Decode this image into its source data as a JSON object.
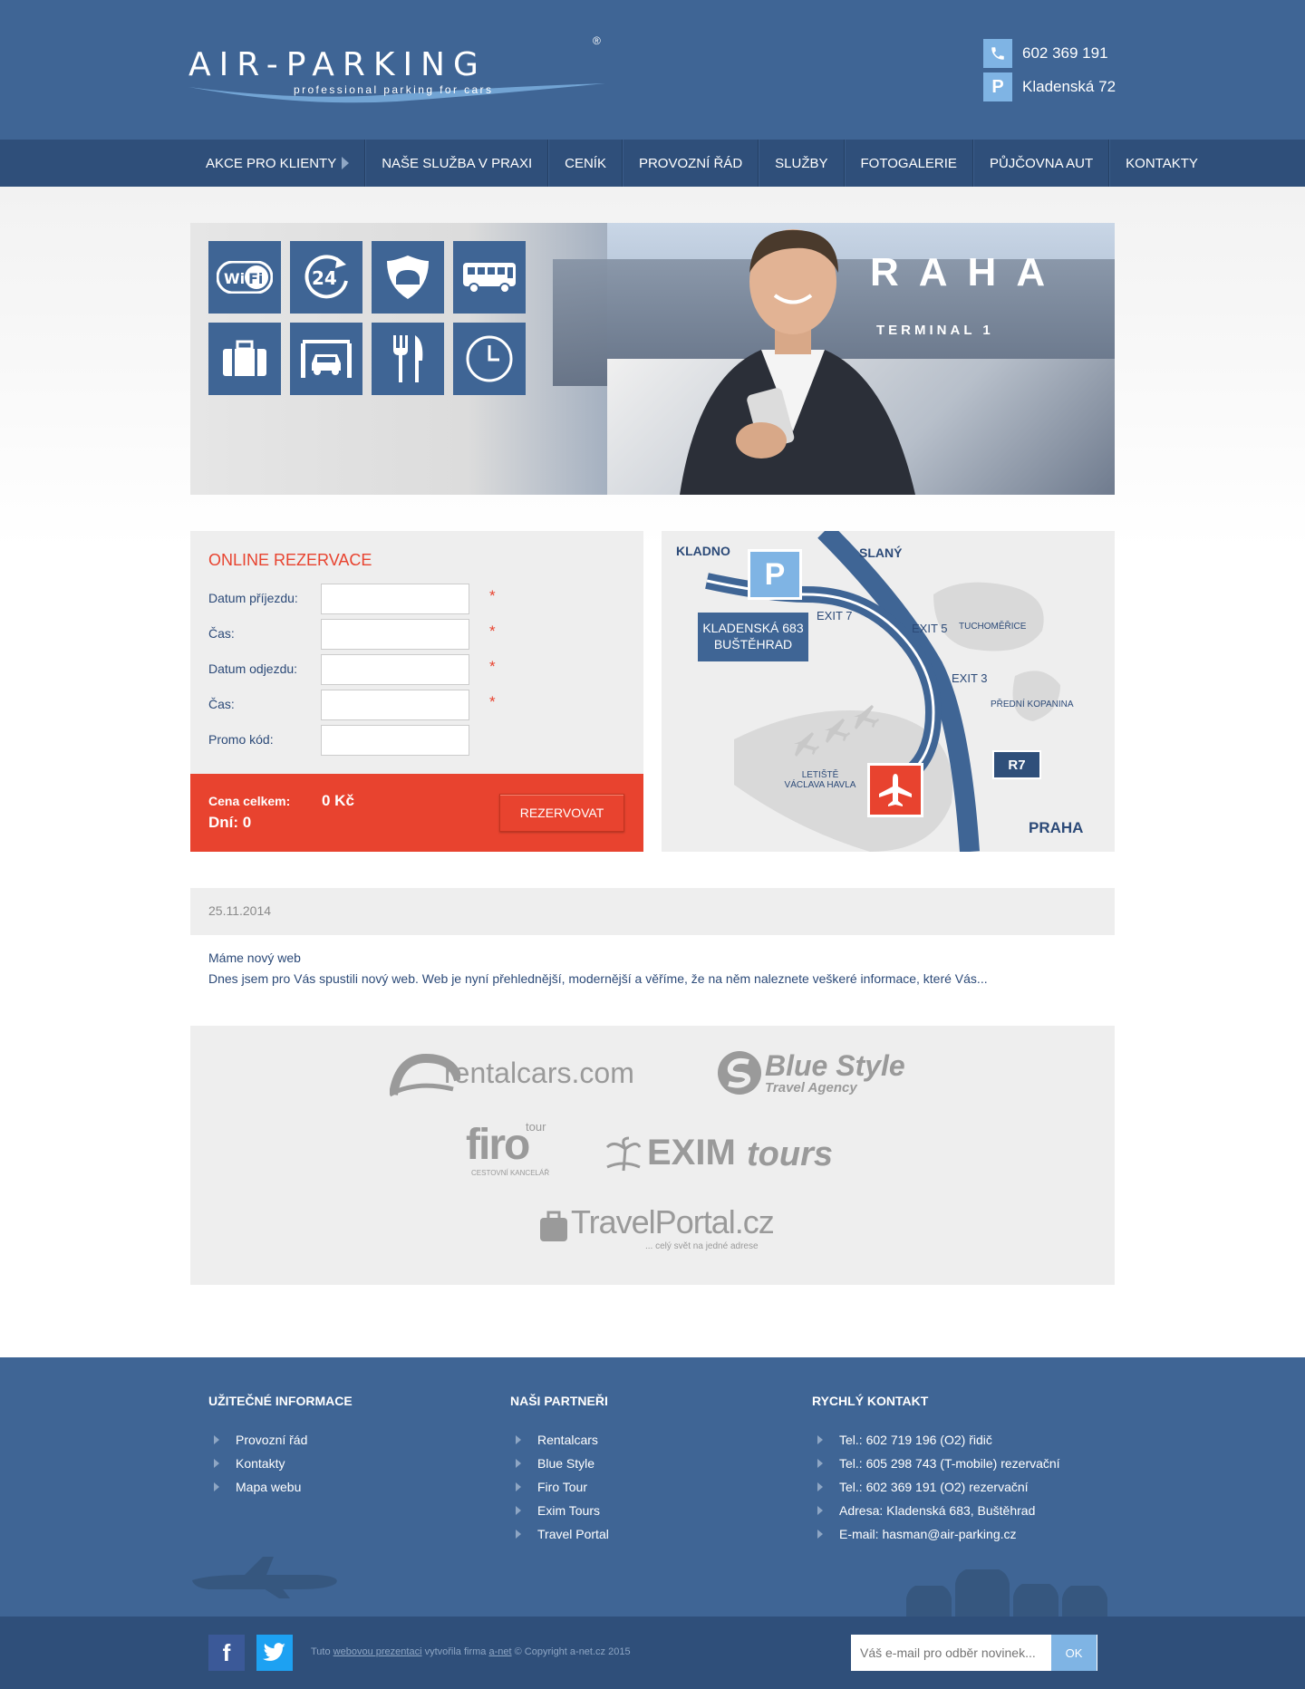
{
  "header": {
    "logo_text": "AIR-PARKING",
    "logo_reg": "®",
    "logo_tagline": "professional parking for cars",
    "phone": "602 369 191",
    "address": "Kladenská 72",
    "phone_icon": "phone-icon",
    "parking_icon_letter": "P"
  },
  "nav": {
    "items": [
      {
        "label": "AKCE PRO KLIENTY"
      },
      {
        "label": "NAŠE SLUŽBA V PRAXI"
      },
      {
        "label": "CENÍK"
      },
      {
        "label": "PROVOZNÍ ŘÁD"
      },
      {
        "label": "SLUŽBY"
      },
      {
        "label": "FOTOGALERIE"
      },
      {
        "label": "PŮJČOVNA AUT"
      },
      {
        "label": "KONTAKTY"
      }
    ]
  },
  "hero": {
    "sign_text": "RAHA",
    "terminal_text": "TERMINAL 1",
    "services": [
      "wifi-icon",
      "24h-icon",
      "security-shield-icon",
      "shuttle-bus-icon",
      "luggage-icon",
      "car-wash-icon",
      "restaurant-icon",
      "clock-icon"
    ],
    "wifi_label": "WiFi",
    "hours_label": "24"
  },
  "reservation": {
    "title": "ONLINE REZERVACE",
    "fields": [
      {
        "label": "Datum příjezdu:",
        "value": "",
        "required": "*"
      },
      {
        "label": "Čas:",
        "value": "",
        "required": "*"
      },
      {
        "label": "Datum odjezdu:",
        "value": "",
        "required": "*"
      },
      {
        "label": "Čas:",
        "value": "",
        "required": "*"
      },
      {
        "label": "Promo kód:",
        "value": "",
        "required": ""
      }
    ],
    "total_label": "Cena celkem:",
    "total_value": "0 Kč",
    "days_label": "Dní: 0",
    "submit_label": "REZERVOVAT"
  },
  "map": {
    "kladno": "KLADNO",
    "slany": "SLANÝ",
    "parking_letter": "P",
    "address_line1": "KLADENSKÁ 683",
    "address_line2": "BUŠTĚHRAD",
    "exit7": "EXIT 7",
    "exit5": "EXIT 5",
    "exit3": "EXIT 3",
    "tuchomerice": "TUCHOMĚŘICE",
    "predni_kopanina": "PŘEDNÍ KOPANINA",
    "airport_line1": "LETIŠTĚ",
    "airport_line2": "VÁCLAVA HAVLA",
    "road": "R7",
    "praha": "PRAHA",
    "colors": {
      "road": "#3f6595",
      "airport": "#e8432f",
      "parking": "#7fb4e4"
    }
  },
  "news": {
    "date": "25.11.2014",
    "title": "Máme nový web",
    "excerpt": "Dnes jsem pro Vás spustili nový web. Web je nyní přehlednější, modernější a věříme, že na něm naleznete veškeré informace, které Vás..."
  },
  "partners": {
    "rentalcars": "rentalcars.com",
    "bluestyle": "Blue Style",
    "bluestyle_sub": "Travel Agency",
    "firo": "firo",
    "firo_tour": "tour",
    "firo_sub": "CESTOVNÍ KANCELÁŘ",
    "exim": "EXIM",
    "exim_tours": "tours",
    "travelportal": "TravelPortal.cz",
    "travelportal_sub": "... celý svět na jedné adrese"
  },
  "footer": {
    "col1": {
      "title": "UŽITEČNÉ INFORMACE",
      "links": [
        "Provozní řád",
        "Kontakty",
        "Mapa webu"
      ]
    },
    "col2": {
      "title": "NAŠI PARTNEŘI",
      "links": [
        "Rentalcars",
        "Blue Style",
        "Firo Tour",
        "Exim Tours",
        "Travel Portal"
      ]
    },
    "col3": {
      "title": "RYCHLÝ KONTAKT",
      "links": [
        "Tel.: 602 719 196 (O2) řidič",
        "Tel.: 605 298 743 (T-mobile) rezervační",
        "Tel.: 602 369 191 (O2) rezervační",
        "Adresa: Kladenská 683, Buštěhrad",
        "E-mail: hasman@air-parking.cz"
      ]
    },
    "copyright_prefix": "Tuto ",
    "copyright_link1": "webovou prezentaci",
    "copyright_mid": " vytvořila firma ",
    "copyright_link2": "a-net",
    "copyright_suffix": " © Copyright a-net.cz 2015",
    "newsletter_placeholder": "Váš e-mail pro odběr novinek...",
    "newsletter_button": "OK",
    "facebook_letter": "f",
    "colors": {
      "facebook": "#3b5998",
      "twitter": "#1da1f2"
    }
  }
}
